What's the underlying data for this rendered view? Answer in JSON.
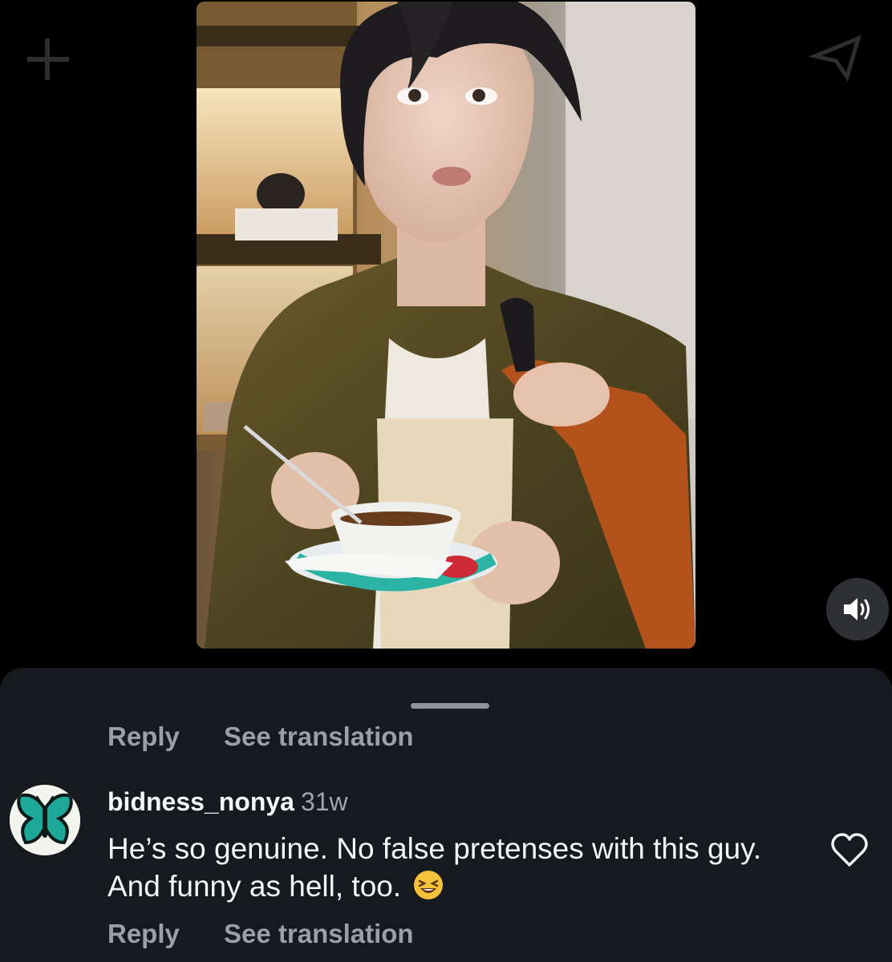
{
  "background_icons": {
    "left": "faint-plus-icon",
    "right": "faint-share-icon"
  },
  "video": {
    "icon": "video-frame",
    "volume_icon": "speaker-volume-icon"
  },
  "comment_sheet": {
    "previous_comment_actions": {
      "reply_label": "Reply",
      "see_translation_label": "See translation"
    },
    "comment": {
      "avatar_icon": "butterfly-avatar-icon",
      "username": "bidness_nonya",
      "age": "31w",
      "text": "He’s so genuine. No false pretenses with this guy. And funny as hell, too.",
      "emoji_icon": "laughing-face-emoji-icon",
      "like_icon": "heart-outline-icon",
      "reply_label": "Reply",
      "see_translation_label": "See translation"
    }
  },
  "colors": {
    "page_background": "#000000",
    "sheet_background": "#16191e",
    "action_text": "#9aa0a6",
    "primary_text": "#f4f5f6"
  }
}
